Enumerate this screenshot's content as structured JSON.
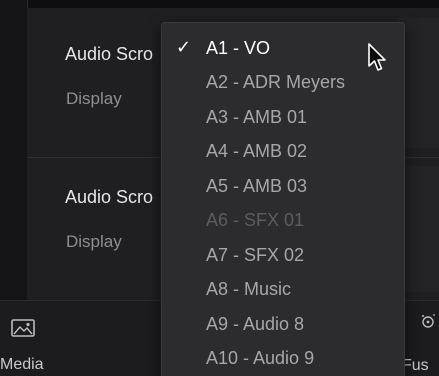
{
  "panel": {
    "sections": [
      {
        "title": "Audio Scro",
        "subtitle": "Display"
      },
      {
        "title": "Audio Scro",
        "subtitle": "Display"
      }
    ]
  },
  "bottom_bar": {
    "media_label": "Media",
    "fusion_label": "Fus"
  },
  "track_menu": {
    "selected_index": 0,
    "items": [
      {
        "label": "A1 - VO",
        "selected": true,
        "disabled": false
      },
      {
        "label": "A2 - ADR Meyers",
        "selected": false,
        "disabled": false
      },
      {
        "label": "A3 - AMB 01",
        "selected": false,
        "disabled": false
      },
      {
        "label": "A4 - AMB 02",
        "selected": false,
        "disabled": false
      },
      {
        "label": "A5 - AMB 03",
        "selected": false,
        "disabled": false
      },
      {
        "label": "A6 - SFX 01",
        "selected": false,
        "disabled": true
      },
      {
        "label": "A7 - SFX 02",
        "selected": false,
        "disabled": false
      },
      {
        "label": "A8 - Music",
        "selected": false,
        "disabled": false
      },
      {
        "label": "A9 - Audio 8",
        "selected": false,
        "disabled": false
      },
      {
        "label": "A10 - Audio 9",
        "selected": false,
        "disabled": false
      }
    ]
  },
  "icons": {
    "check": "checkmark-icon",
    "cursor": "mouse-pointer-icon",
    "media": "media-pool-icon",
    "fusion": "fusion-icon"
  },
  "colors": {
    "menu_background": "#2c2c2e",
    "item_text": "#a7a7ab",
    "selected_text": "#ffffff",
    "disabled_text": "#5d5d61"
  }
}
